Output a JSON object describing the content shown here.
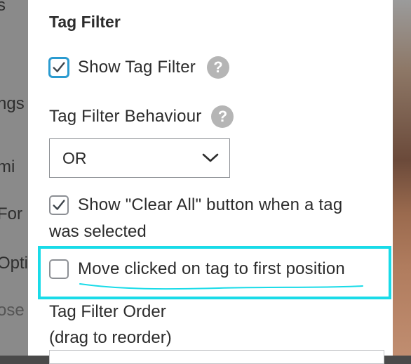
{
  "background_fragments": [
    "s",
    "ngs",
    "mi",
    "For",
    "Opti",
    "ose"
  ],
  "section": {
    "title": "Tag Filter",
    "show_tag_filter": {
      "label": "Show Tag Filter",
      "checked": true
    },
    "behaviour": {
      "label": "Tag Filter Behaviour",
      "selected": "OR"
    },
    "clear_all": {
      "line1": "Show \"Clear All\" button when a tag",
      "line2": "was selected",
      "checked": true
    },
    "move_clicked": {
      "label": "Move clicked on tag to first position",
      "checked": false
    },
    "order": {
      "line1": "Tag Filter Order",
      "line2": "(drag to reorder)"
    },
    "help_glyph": "?"
  },
  "colors": {
    "highlight": "#19dbe8",
    "checkbox_focus": "#2b9bd0",
    "help_icon": "#b5b5b5"
  }
}
